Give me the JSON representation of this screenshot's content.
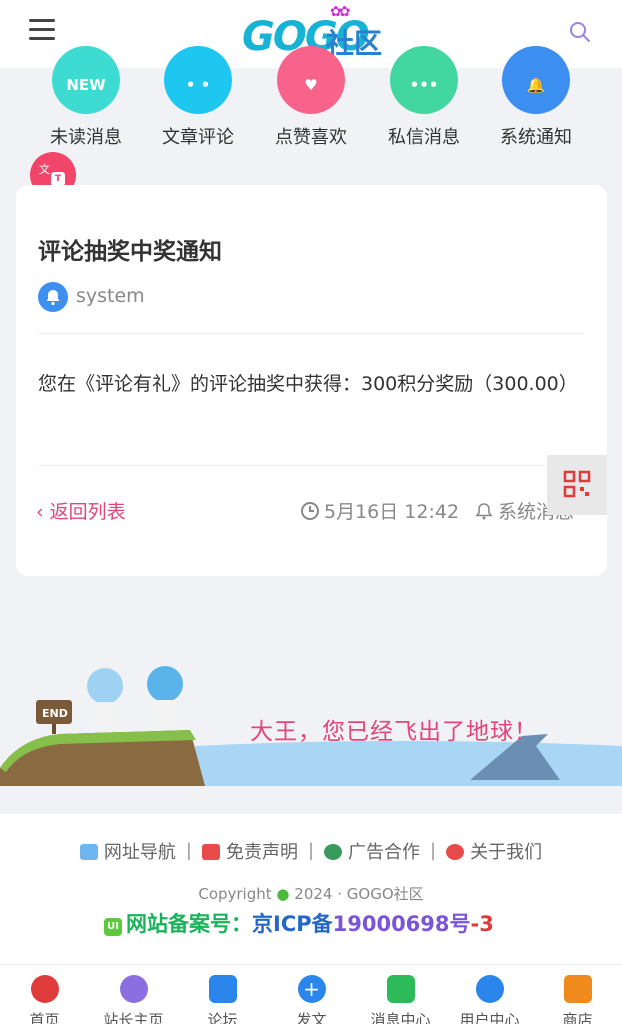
{
  "header": {
    "logo_text": "GOGO",
    "logo_cn": "社区"
  },
  "categories": [
    {
      "label": "未读消息",
      "icon": "new-icon",
      "color": "#3ddbd2"
    },
    {
      "label": "文章评论",
      "icon": "comment-icon",
      "color": "#1ec7ef"
    },
    {
      "label": "点赞喜欢",
      "icon": "heart-icon",
      "color": "#f7638a"
    },
    {
      "label": "私信消息",
      "icon": "chat-icon",
      "color": "#42d6a1"
    },
    {
      "label": "系统通知",
      "icon": "bell-icon",
      "color": "#3c8ff0"
    }
  ],
  "notice": {
    "title": "评论抽奖中奖通知",
    "author": "system",
    "content": "您在《评论有礼》的评论抽奖中获得：300积分奖励（300.00）",
    "back_label": "返回列表",
    "time": "5月16日 12:42",
    "type": "系统消息"
  },
  "illustration": {
    "text": "大王，您已经飞出了地球！",
    "sign": "END"
  },
  "footer": {
    "links": [
      "网址导航",
      "免责声明",
      "广告合作",
      "关于我们"
    ],
    "copyright_prefix": "Copyright",
    "copyright_suffix": "2024 · GOGO社区",
    "icp_badge": "UI",
    "icp_label": "网站备案号：",
    "icp_code_a": "京ICP备",
    "icp_code_b": "19000698号",
    "icp_code_c": "-3"
  },
  "tabbar": [
    {
      "label": "首页",
      "icon": "home-icon",
      "color": "#e03b3b"
    },
    {
      "label": "站长主页",
      "icon": "admin-icon",
      "color": "#8b6fe0"
    },
    {
      "label": "论坛",
      "icon": "forum-icon",
      "color": "#2a86ea"
    },
    {
      "label": "发文",
      "icon": "post-icon",
      "color": "#2a86ea"
    },
    {
      "label": "消息中心",
      "icon": "message-icon",
      "color": "#2dbb5a"
    },
    {
      "label": "用户中心",
      "icon": "user-icon",
      "color": "#2a86ea"
    },
    {
      "label": "商店",
      "icon": "shop-icon",
      "color": "#f08a1c"
    }
  ]
}
